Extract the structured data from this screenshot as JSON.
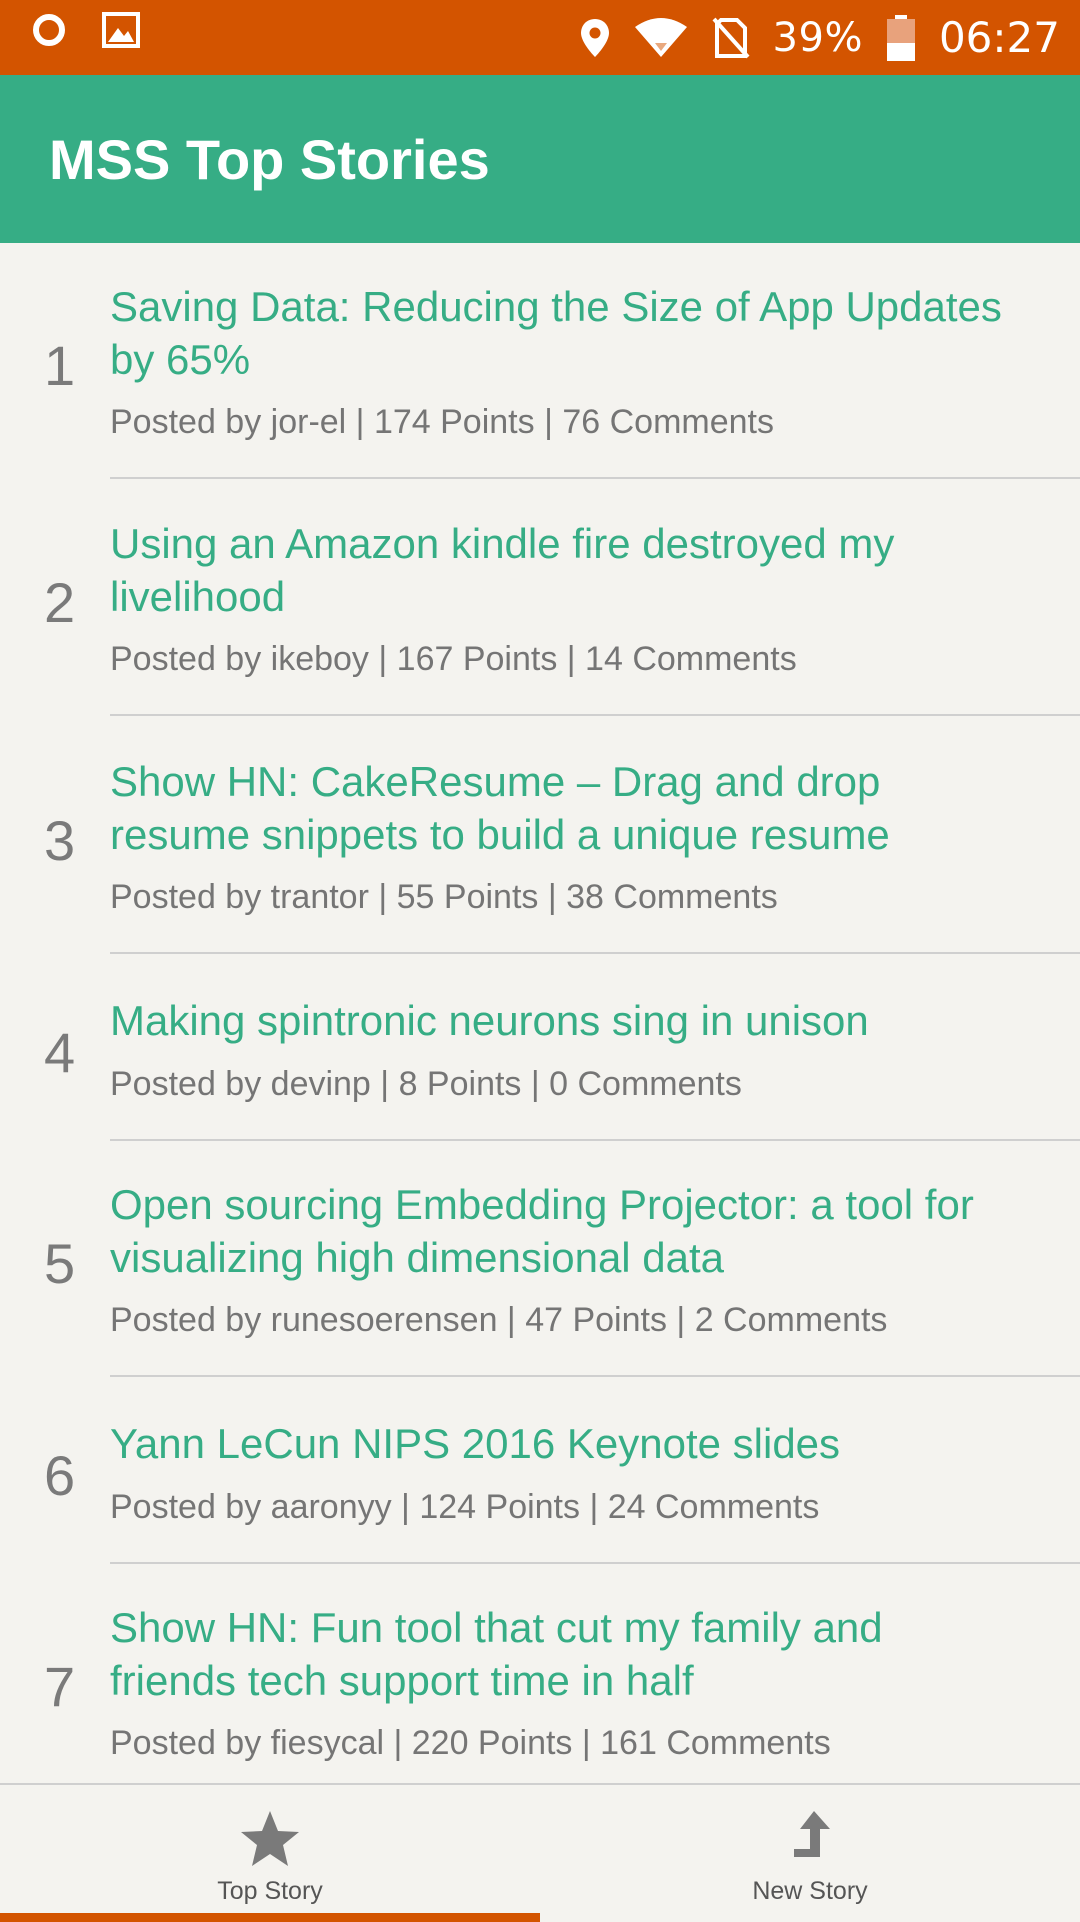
{
  "status_bar": {
    "battery": "39%",
    "time": "06:27",
    "icons": [
      "record-icon",
      "image-icon",
      "location-icon",
      "wifi-icon",
      "no-sim-icon",
      "battery-icon"
    ]
  },
  "app": {
    "title": "MSS Top Stories"
  },
  "stories": [
    {
      "rank": "1",
      "title_lines": [
        "Saving Data: Reducing the Size of App Updates",
        "by 65%"
      ],
      "meta": "Posted by jor-el | 174 Points | 76 Comments"
    },
    {
      "rank": "2",
      "title_lines": [
        "Using an Amazon kindle fire destroyed my",
        "livelihood"
      ],
      "meta": "Posted by ikeboy | 167 Points | 14 Comments"
    },
    {
      "rank": "3",
      "title_lines": [
        "Show HN: CakeResume – Drag and drop",
        "resume snippets to build a unique resume"
      ],
      "meta": "Posted by trantor | 55 Points | 38 Comments"
    },
    {
      "rank": "4",
      "title_lines": [
        "Making spintronic neurons sing in unison"
      ],
      "meta": "Posted by devinp | 8 Points | 0 Comments"
    },
    {
      "rank": "5",
      "title_lines": [
        "Open sourcing Embedding Projector: a tool for",
        "visualizing high dimensional data"
      ],
      "meta": "Posted by runesoerensen | 47 Points | 2 Comments"
    },
    {
      "rank": "6",
      "title_lines": [
        "Yann LeCun NIPS 2016 Keynote slides"
      ],
      "meta": "Posted by aaronyy | 124 Points | 24 Comments"
    },
    {
      "rank": "7",
      "title_lines": [
        "Show HN: Fun tool that cut my family and",
        "friends tech support time in half"
      ],
      "meta": "Posted by fiesycal | 220 Points | 161 Comments"
    }
  ],
  "bottom_nav": {
    "top_story_label": "Top Story",
    "new_story_label": "New Story"
  },
  "colors": {
    "status_bar": "#d35400",
    "app_bar": "#36ad85",
    "accent": "#36ad85",
    "indicator": "#d35400"
  }
}
